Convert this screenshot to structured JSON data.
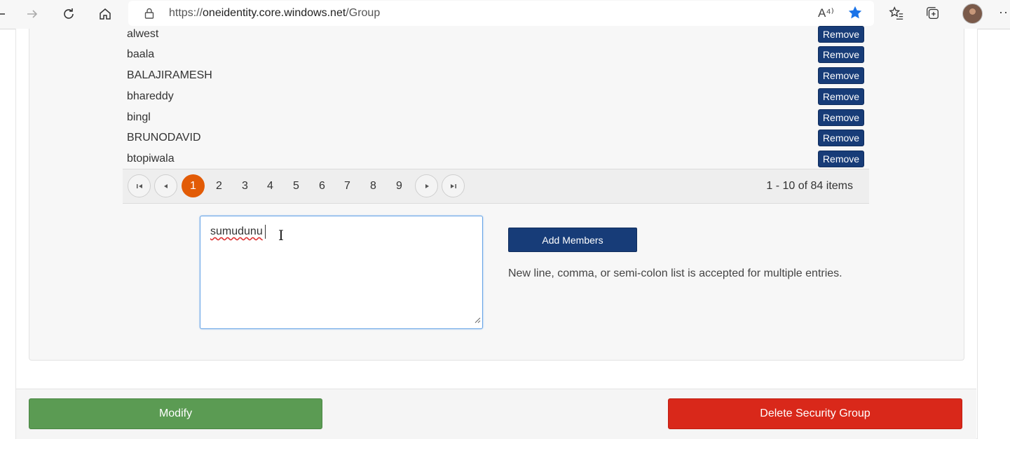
{
  "browser": {
    "url_prefix": "https://",
    "url_domain": "oneidentity.core.windows.net",
    "url_path": "/Group",
    "read_aloud_label": "A⁴⁾",
    "more_label": "···"
  },
  "members": [
    {
      "name": "alwest",
      "remove_label": "Remove"
    },
    {
      "name": "baala",
      "remove_label": "Remove"
    },
    {
      "name": "BALAJIRAMESH",
      "remove_label": "Remove"
    },
    {
      "name": "bhareddy",
      "remove_label": "Remove"
    },
    {
      "name": "bingl",
      "remove_label": "Remove"
    },
    {
      "name": "BRUNODAVID",
      "remove_label": "Remove"
    },
    {
      "name": "btopiwala",
      "remove_label": "Remove"
    }
  ],
  "pager": {
    "pages": [
      "1",
      "2",
      "3",
      "4",
      "5",
      "6",
      "7",
      "8",
      "9"
    ],
    "active_page": "1",
    "info": "1 - 10 of 84 items",
    "accent": "#e25b06"
  },
  "add_members": {
    "entry_value": "sumudunu",
    "button_label": "Add Members",
    "hint": "New line, comma, or semi-colon list is accepted for multiple entries."
  },
  "actions": {
    "modify_label": "Modify",
    "delete_label": "Delete Security Group"
  },
  "colors": {
    "primary": "#173c78",
    "success": "#5b9b53",
    "danger": "#d9281a"
  }
}
